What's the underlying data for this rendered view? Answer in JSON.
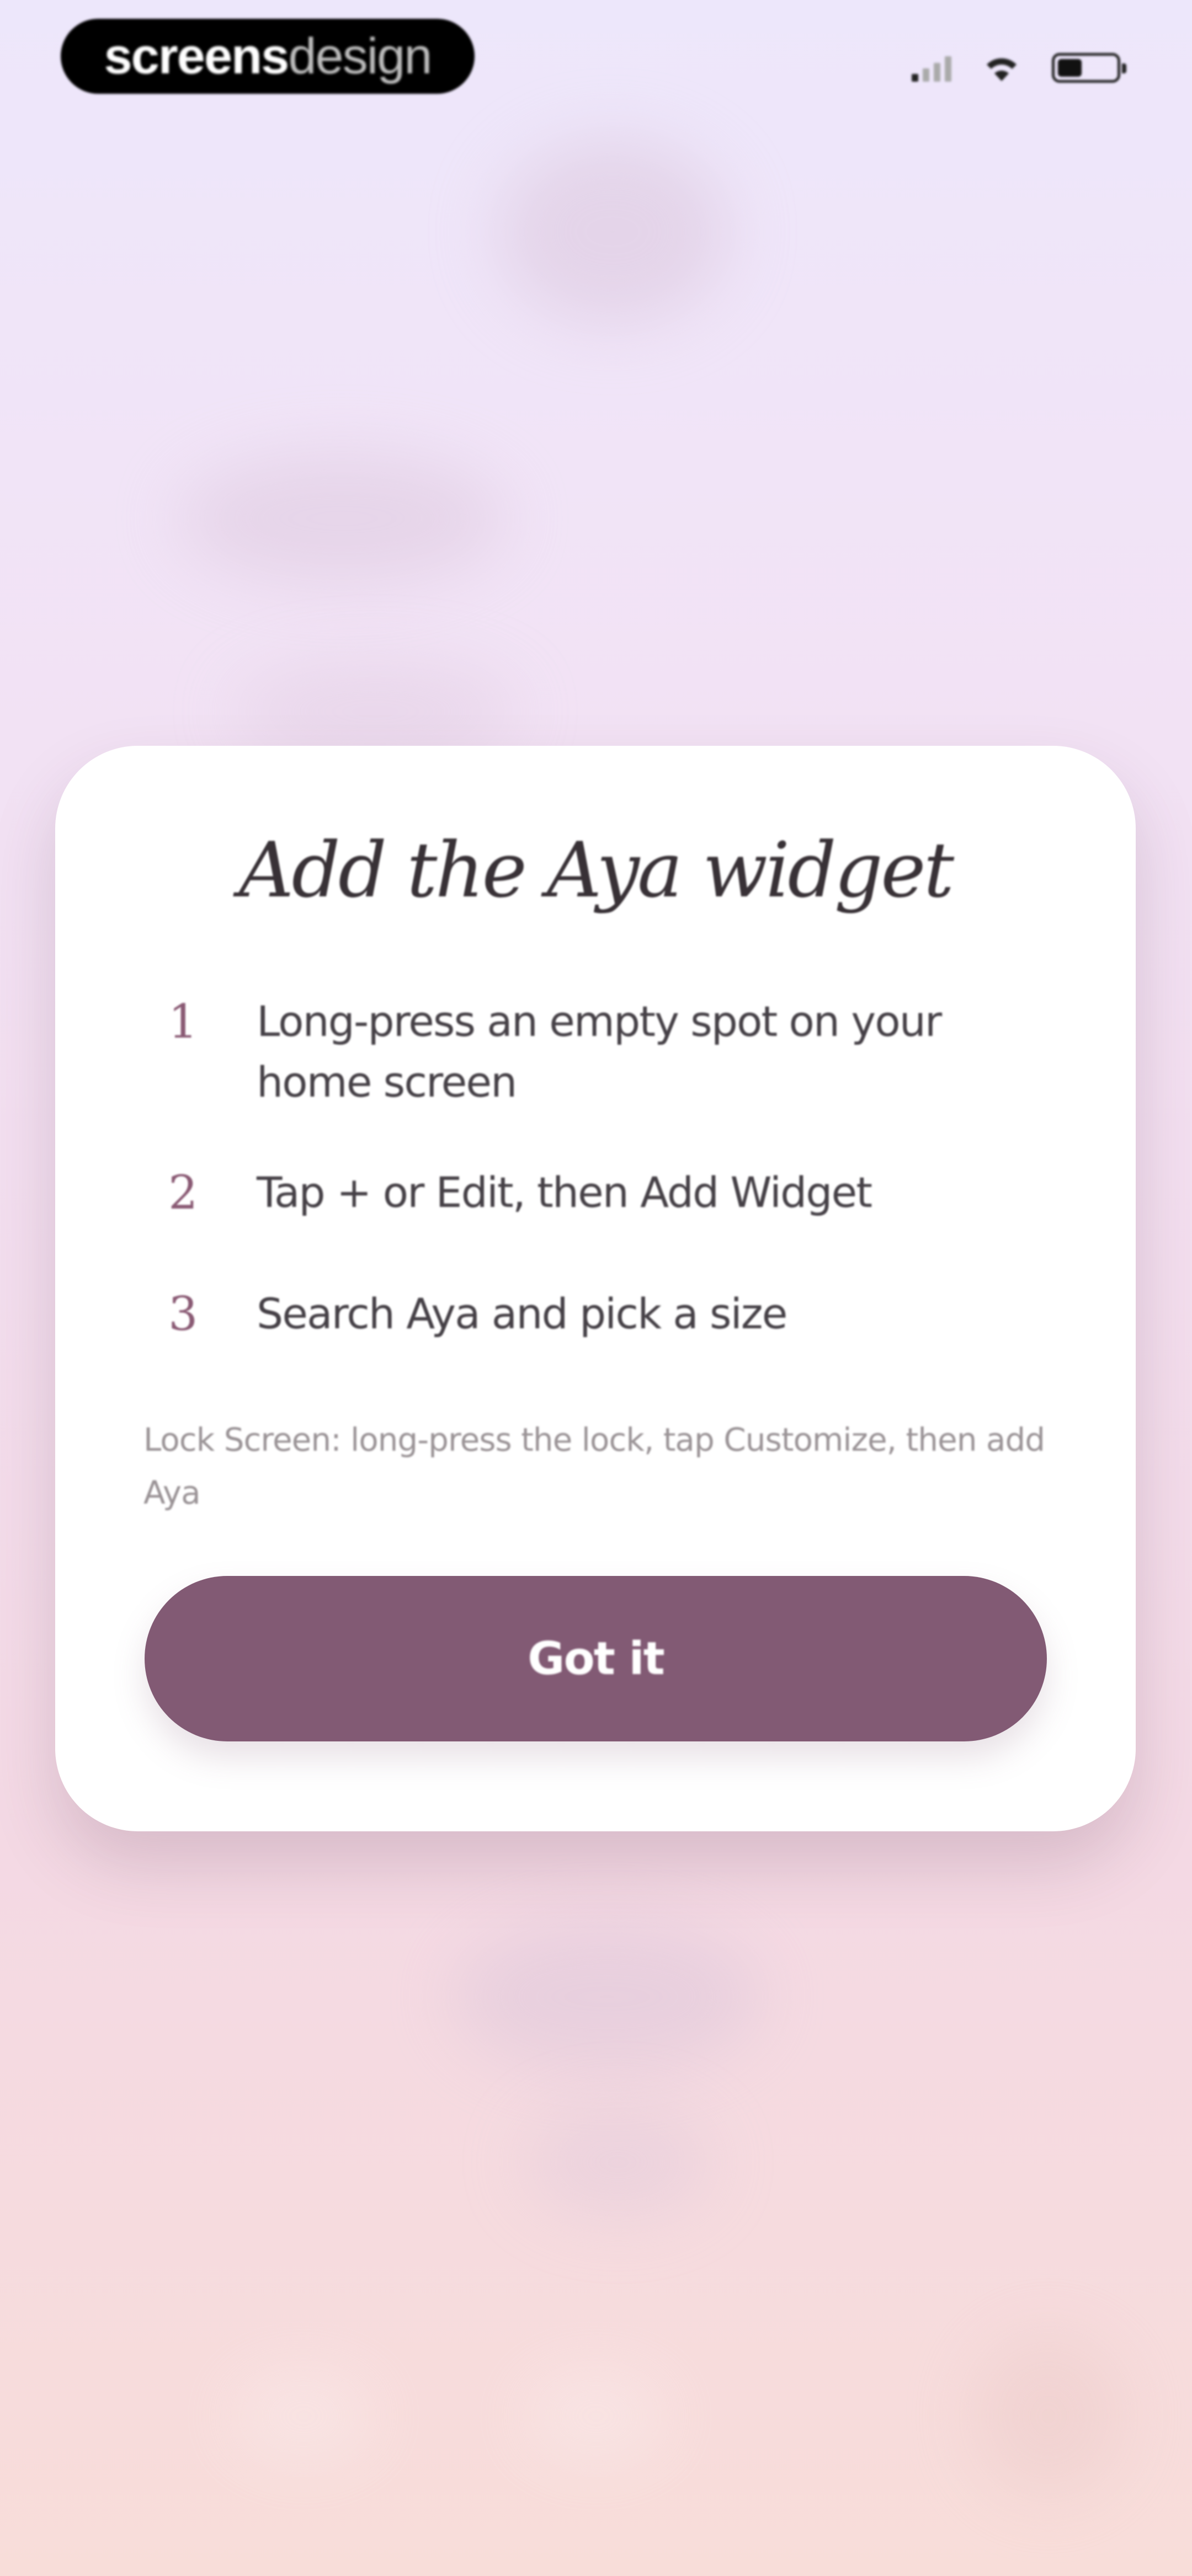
{
  "status_bar": {
    "brand_primary": "screens",
    "brand_secondary": "design",
    "icons": [
      "cellular-signal-icon",
      "wifi-icon",
      "battery-icon"
    ]
  },
  "modal": {
    "title": "Add the Aya widget",
    "steps": [
      {
        "number": "1",
        "text": "Long-press an empty spot on your home screen"
      },
      {
        "number": "2",
        "text": "Tap + or Edit, then Add Widget"
      },
      {
        "number": "3",
        "text": "Search Aya and pick a size"
      }
    ],
    "note": "Lock Screen: long-press the lock, tap Customize, then add Aya",
    "button_label": "Got it"
  },
  "colors": {
    "accent": "#825a74",
    "card": "#ffffff",
    "title_text": "#383136",
    "step_number": "#8a5a74",
    "background_top": "#ede7fb",
    "background_bottom": "#f8ddd9"
  }
}
